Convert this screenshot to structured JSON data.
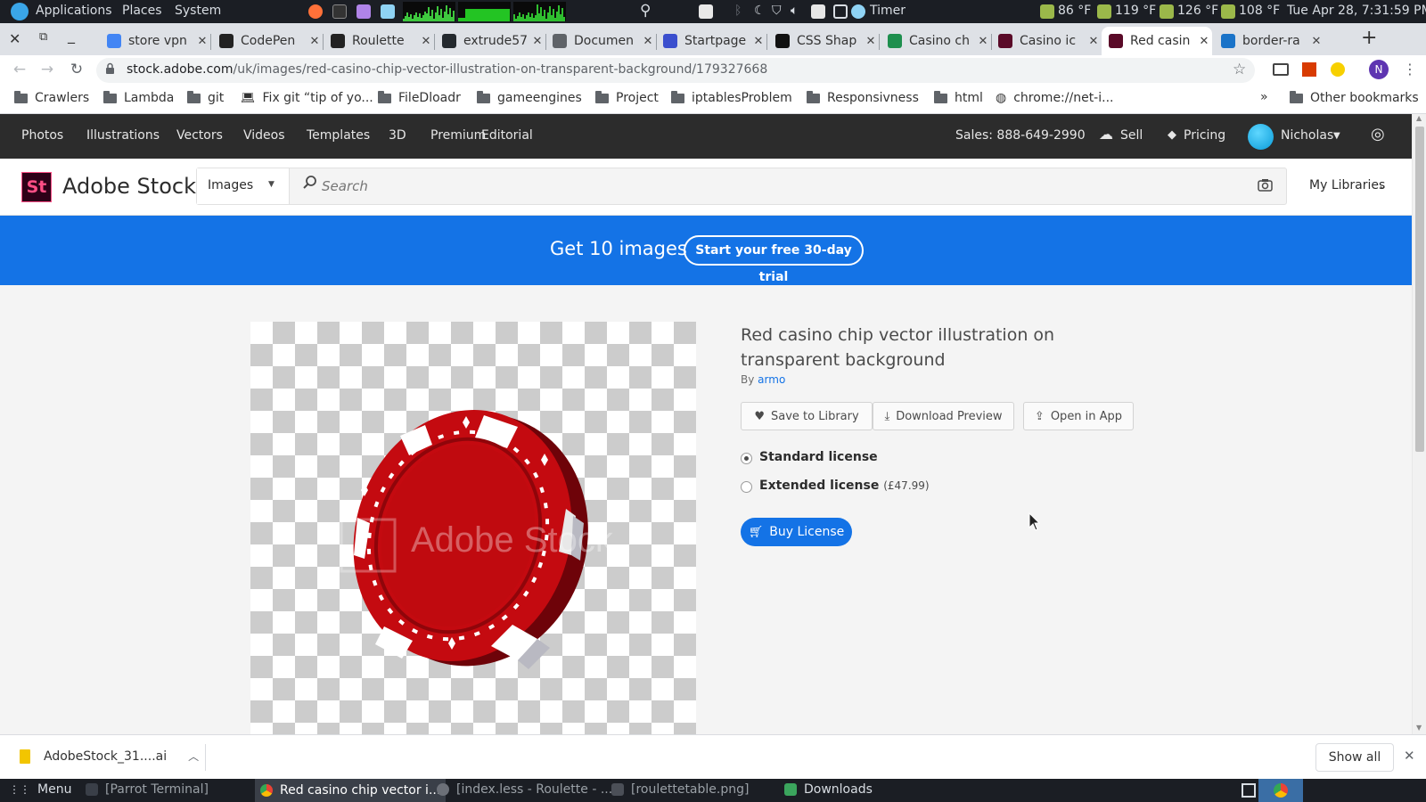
{
  "os_panel": {
    "menus": [
      "Applications",
      "Places",
      "System"
    ],
    "timer_label": "Timer",
    "temps": [
      "86 °F",
      "119 °F",
      "126 °F",
      "108 °F"
    ],
    "clock": "Tue Apr 28, 7:31:59 PM"
  },
  "browser": {
    "tabs": [
      {
        "label": "store vpn",
        "icon": "google-icon",
        "color": "#4285f4"
      },
      {
        "label": "CodePen",
        "icon": "codepen-icon",
        "color": "#222222"
      },
      {
        "label": "Roulette",
        "icon": "codepen-icon",
        "color": "#222222"
      },
      {
        "label": "extrude57",
        "icon": "github-icon",
        "color": "#24292e"
      },
      {
        "label": "Documen",
        "icon": "globe-icon",
        "color": "#5f6368"
      },
      {
        "label": "Startpage",
        "icon": "startpage-icon",
        "color": "#3b4fce"
      },
      {
        "label": "CSS Shap",
        "icon": "css-tricks-icon",
        "color": "#111111"
      },
      {
        "label": "Casino ch",
        "icon": "vectr-icon",
        "color": "#1e8f4e"
      },
      {
        "label": "Casino ic",
        "icon": "adobe-stock-icon",
        "color": "#5a0a28"
      },
      {
        "label": "Red casin",
        "icon": "adobe-stock-icon",
        "color": "#5a0a28",
        "active": true
      },
      {
        "label": "border-ra",
        "icon": "w3schools-icon",
        "color": "#1a73c8"
      }
    ],
    "url_host": "stock.adobe.com",
    "url_path": "/uk/images/red-casino-chip-vector-illustration-on-transparent-background/179327668",
    "profile_initial": "N",
    "bookmarks": [
      "Crawlers",
      "Lambda",
      "git",
      "Fix git “tip of yo...",
      "FileDloadr",
      "gameengines",
      "Project",
      "iptablesProblem",
      "Responsivness",
      "html",
      "chrome://net-i..."
    ],
    "overflow_label": "»",
    "other_bookmarks": "Other bookmarks"
  },
  "stock": {
    "nav": [
      "Photos",
      "Illustrations",
      "Vectors",
      "Videos",
      "Templates",
      "3D",
      "Premium",
      "Editorial"
    ],
    "sales": "Sales: 888-649-2990",
    "sell": "Sell",
    "pricing": "Pricing",
    "user": "Nicholas",
    "logo_mark": "St",
    "logo_text": "Adobe Stock",
    "search_type": "Images",
    "search_placeholder": "Search",
    "my_libraries": "My Libraries",
    "promo_text": "Get 10 images",
    "promo_button": "Start your free 30-day trial",
    "watermark": "Adobe Stock",
    "asset": {
      "title": "Red casino chip vector illustration on transparent background",
      "by_prefix": "By",
      "author": "armo"
    },
    "actions": {
      "save": "Save to Library",
      "download": "Download Preview",
      "open": "Open in App"
    },
    "licenses": {
      "standard": "Standard license",
      "extended": "Extended license",
      "extended_price": "(£47.99)",
      "selected": "standard"
    },
    "buy": "Buy License"
  },
  "download_bar": {
    "file": "AdobeStock_31....ai",
    "show_all": "Show all"
  },
  "taskbar": {
    "menu": "Menu",
    "items": [
      "[Parrot Terminal]",
      "Red casino chip vector i...",
      "[index.less - Roulette - ...",
      "[roulettetable.png]",
      "Downloads"
    ]
  },
  "colors": {
    "accent": "#1473e6",
    "chip_red": "#c40a10",
    "dark_nav": "#2c2c2c"
  }
}
